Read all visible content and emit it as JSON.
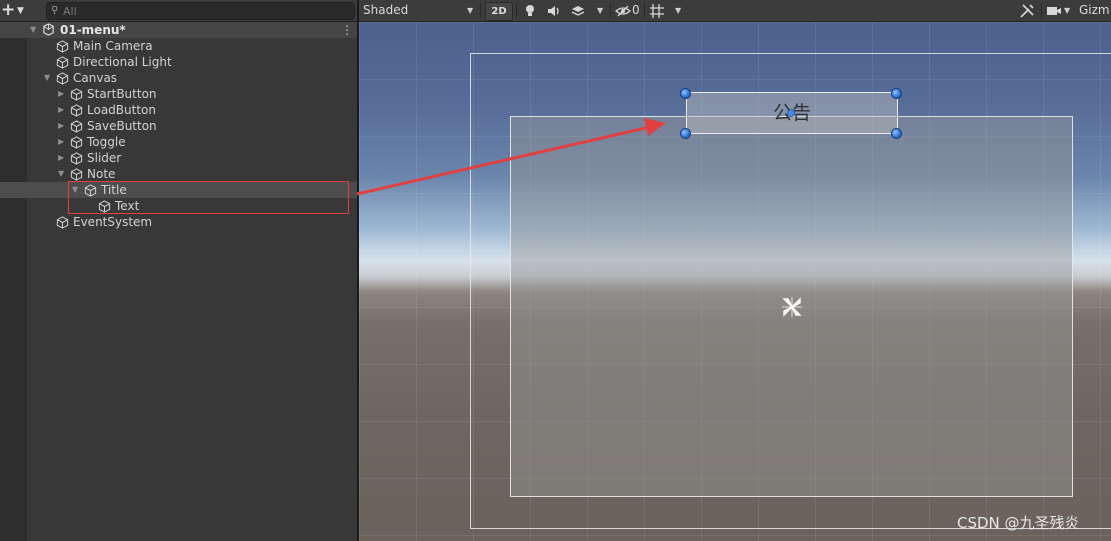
{
  "hierarchy": {
    "add_button": {
      "icon": "plus-icon"
    },
    "search": {
      "placeholder": "All",
      "value": ""
    },
    "scene": {
      "name": "01-menu*"
    },
    "items": [
      {
        "label": "Main Camera",
        "depth": 1,
        "expand": "none"
      },
      {
        "label": "Directional Light",
        "depth": 1,
        "expand": "none"
      },
      {
        "label": "Canvas",
        "depth": 1,
        "expand": "expanded"
      },
      {
        "label": "StartButton",
        "depth": 2,
        "expand": "collapsed"
      },
      {
        "label": "LoadButton",
        "depth": 2,
        "expand": "collapsed"
      },
      {
        "label": "SaveButton",
        "depth": 2,
        "expand": "collapsed"
      },
      {
        "label": "Toggle",
        "depth": 2,
        "expand": "collapsed"
      },
      {
        "label": "Slider",
        "depth": 2,
        "expand": "collapsed"
      },
      {
        "label": "Note",
        "depth": 2,
        "expand": "expanded"
      },
      {
        "label": "Title",
        "depth": 3,
        "expand": "expanded",
        "selected": true
      },
      {
        "label": "Text",
        "depth": 4,
        "expand": "none"
      },
      {
        "label": "EventSystem",
        "depth": 1,
        "expand": "none"
      }
    ]
  },
  "scene_toolbar": {
    "shading_mode": "Shaded",
    "mode_2d": "2D",
    "hidden_count": "0",
    "gizmos_label": "Gizm",
    "icons": [
      "lightbulb-icon",
      "audio-icon",
      "effects-icon",
      "visibility-icon",
      "grid-icon",
      "tools-icon",
      "camera-icon"
    ]
  },
  "scene_view": {
    "title_text": "公告",
    "watermark": "CSDN @九圣残炎"
  },
  "colors": {
    "annotation_red": "#e04040",
    "handle_blue": "#2a6fd6",
    "panel_bg": "#383838",
    "selection_row": "#4d4d4d"
  }
}
